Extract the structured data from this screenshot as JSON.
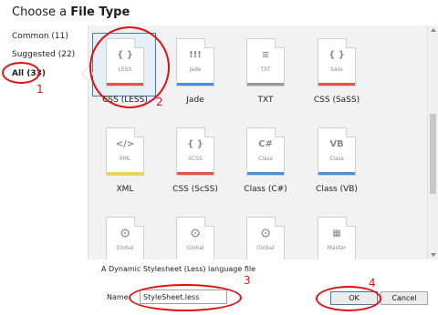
{
  "dialog": {
    "title_prefix": "Choose a ",
    "title_bold": "File Type"
  },
  "categories": [
    {
      "label": "Common (11)",
      "active": false
    },
    {
      "label": "Suggested (22)",
      "active": false
    },
    {
      "label": "All (33)",
      "active": true
    }
  ],
  "tiles": [
    {
      "label": "CSS (LESS)",
      "glyph": "{ }",
      "sub": "LESS",
      "stripe": "#e8504a",
      "icon": "css-less-file-icon",
      "selected": true
    },
    {
      "label": "Jade",
      "glyph": "!!!",
      "sub": "Jade",
      "stripe": "#4a90d9",
      "icon": "jade-file-icon",
      "selected": false
    },
    {
      "label": "TXT",
      "glyph": "≡",
      "sub": "TXT",
      "stripe": "#9a9a9a",
      "icon": "txt-file-icon",
      "selected": false
    },
    {
      "label": "CSS (SaSS)",
      "glyph": "{ }",
      "sub": "Sass",
      "stripe": "#e8504a",
      "icon": "css-sass-file-icon",
      "selected": false
    },
    {
      "label": "XML",
      "glyph": "</>",
      "sub": "XML",
      "stripe": "#e8d84a",
      "icon": "xml-file-icon",
      "selected": false
    },
    {
      "label": "CSS (ScSS)",
      "glyph": "{ }",
      "sub": "SCSS",
      "stripe": "#e8504a",
      "icon": "css-scss-file-icon",
      "selected": false
    },
    {
      "label": "Class (C#)",
      "glyph": "C#",
      "sub": "Class",
      "stripe": "#4a90d9",
      "icon": "csharp-class-file-icon",
      "selected": false
    },
    {
      "label": "Class (VB)",
      "glyph": "VB",
      "sub": "Class",
      "stripe": "#4a90d9",
      "icon": "vb-class-file-icon",
      "selected": false
    },
    {
      "label": "",
      "glyph": "⚙",
      "sub": "Global",
      "stripe": "#4a90d9",
      "icon": "global-file-icon",
      "selected": false
    },
    {
      "label": "",
      "glyph": "⚙",
      "sub": "Global",
      "stripe": "#4a90d9",
      "icon": "global-file-icon",
      "selected": false
    },
    {
      "label": "",
      "glyph": "⚙",
      "sub": "Global",
      "stripe": "#4a90d9",
      "icon": "global-file-icon",
      "selected": false
    },
    {
      "label": "",
      "glyph": "▦",
      "sub": "Master",
      "stripe": "#4a90d9",
      "icon": "master-file-icon",
      "selected": false
    }
  ],
  "description": "A Dynamic Stylesheet (Less) language file",
  "name_field": {
    "label": "Name",
    "value": "StyleSheet.less"
  },
  "buttons": {
    "ok": "OK",
    "cancel": "Cancel"
  },
  "annotations": [
    "1",
    "2",
    "3",
    "4"
  ],
  "colors": {
    "annotation": "#e01010",
    "selection": "#3c7fb1"
  }
}
